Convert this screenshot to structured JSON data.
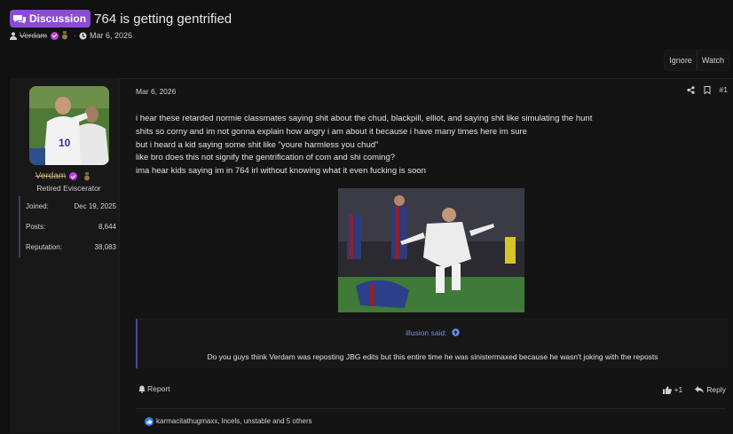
{
  "thread": {
    "prefix": "Discussion",
    "title": "764 is getting gentrified",
    "author": "Verdam",
    "date": "Mar 6, 2026"
  },
  "actions": {
    "ignore": "Ignore",
    "watch": "Watch"
  },
  "post": {
    "date": "Mar 6, 2026",
    "number": "#1",
    "user": {
      "name": "Verdam",
      "title": "Retired Eviscerator",
      "stats": [
        {
          "label": "Joined:",
          "value": "Dec 19, 2025"
        },
        {
          "label": "Posts:",
          "value": "8,644"
        },
        {
          "label": "Reputation:",
          "value": "38,083"
        }
      ]
    },
    "lines": [
      "i hear these retarded normie classmates saying shit about the chud, blackpill, elliot, and saying shit like simulating the hunt",
      "shits so corny and im not gonna explain how angry i am about it because i have many times here im sure",
      "but i heard a kid saying some shit like \"youre harmless you chud\"",
      "like bro does this not signify the gentrification of com and shi coming?",
      "ima hear kids saying im in 764 irl without knowing what it even fucking is soon"
    ],
    "quote": {
      "author": "illusion said:",
      "text": "Do you guys think Verdam was reposting JBG edits but this entire time he was sinistermaxed because he wasn't joking with the reposts"
    },
    "report": "Report",
    "like": "+1",
    "reply": "Reply",
    "reactions": "karmacitathugmaxx, lncels, unstable and 5 others"
  },
  "colors": {
    "prefix_bg": "#8a4bd6",
    "link": "#6f8ce8",
    "background": "#111111"
  }
}
